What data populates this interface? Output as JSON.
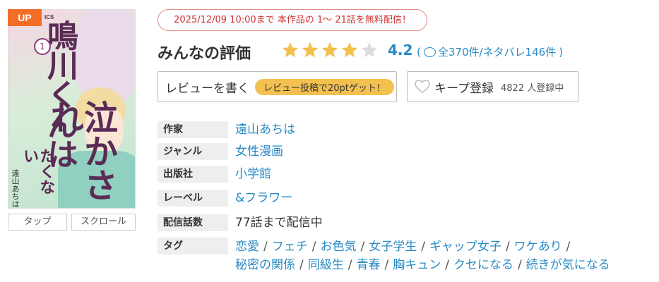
{
  "cover": {
    "badge": "UP",
    "badge_suffix": "ICS",
    "title_part1": "鳴川くんは",
    "title_part2": "泣かされ",
    "title_part3": "たくない",
    "volume": "1",
    "author": "遠山あちは"
  },
  "view_modes": {
    "tap": "タップ",
    "scroll": "スクロール"
  },
  "promo": "2025/12/09 10:00まで 本作品の 1〜 21話を無料配信！",
  "rating": {
    "label": "みんなの評価",
    "score": "4.2",
    "stars_value": 4.2,
    "stars_max": 5,
    "star_color": "#f2c14e",
    "star_empty_color": "#dcdcdc",
    "review_summary": "全370件/ネタバレ146件",
    "paren_open": "(",
    "paren_close": ")"
  },
  "buttons": {
    "write_review": "レビューを書く",
    "review_bonus": "レビュー投稿で20ptゲット！",
    "keep": "キープ登録",
    "keep_count": "4822 人登録中"
  },
  "meta": {
    "author_label": "作家",
    "author_value": "遠山あちは",
    "genre_label": "ジャンル",
    "genre_value": "女性漫画",
    "publisher_label": "出版社",
    "publisher_value": "小学館",
    "label_label": "レーベル",
    "label_value": "&フラワー",
    "episodes_label": "配信話数",
    "episodes_value": "77話まで配信中",
    "tags_label": "タグ",
    "tags": [
      "恋愛",
      "フェチ",
      "お色気",
      "女子学生",
      "ギャップ女子",
      "ワケあり",
      "秘密の関係",
      "同級生",
      "青春",
      "胸キュン",
      "クセになる",
      "続きが気になる"
    ],
    "tag_separator": "/"
  },
  "colors": {
    "accent": "#2a8ac4",
    "badge": "#f26d25",
    "promo": "#cc3333"
  }
}
